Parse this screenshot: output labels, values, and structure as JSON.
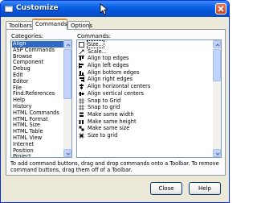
{
  "window": {
    "title": "Customize"
  },
  "tabs": [
    {
      "label": "Toolbars"
    },
    {
      "label": "Commands"
    },
    {
      "label": "Options"
    }
  ],
  "categories": {
    "label": "Categories:",
    "items": [
      "Align",
      "ASP Commands",
      "Browse",
      "Component",
      "Debug",
      "Edit",
      "Editor",
      "File",
      "Find.References",
      "Help",
      "History",
      "HTML Commands",
      "HTML Format",
      "HTML Size",
      "HTML Table",
      "HTML View",
      "Internet",
      "Position",
      "Project"
    ],
    "selected": "Align"
  },
  "commands": {
    "label": "Commands:",
    "items": [
      {
        "label": "Size...",
        "icon": "size-icon"
      },
      {
        "label": "Scale...",
        "icon": "scale-icon"
      },
      {
        "label": "Align top edges",
        "icon": "align-top-icon"
      },
      {
        "label": "Align left edges",
        "icon": "align-left-icon"
      },
      {
        "label": "Align bottom edges",
        "icon": "align-bottom-icon"
      },
      {
        "label": "Align right edges",
        "icon": "align-right-icon"
      },
      {
        "label": "Align horizontal centers",
        "icon": "align-hcenter-icon"
      },
      {
        "label": "Align vertical centers",
        "icon": "align-vcenter-icon"
      },
      {
        "label": "Snap to Grid",
        "icon": "snap-grid-icon"
      },
      {
        "label": "Snap to grid",
        "icon": "snap-grid-icon"
      },
      {
        "label": "Make same width",
        "icon": "same-width-icon"
      },
      {
        "label": "Make same height",
        "icon": "same-height-icon"
      },
      {
        "label": "Make same size",
        "icon": "same-size-icon"
      },
      {
        "label": "Size to grid",
        "icon": "size-grid-icon"
      }
    ]
  },
  "hint": "To add command buttons, drag and drop commands onto a Toolbar. To remove command buttons, drag them off of a Toolbar.",
  "buttons": {
    "close": "Close",
    "help": "Help"
  },
  "colors": {
    "titlebar": "#0553d6",
    "selection": "#316ac5",
    "dialog": "#ece9d8"
  }
}
